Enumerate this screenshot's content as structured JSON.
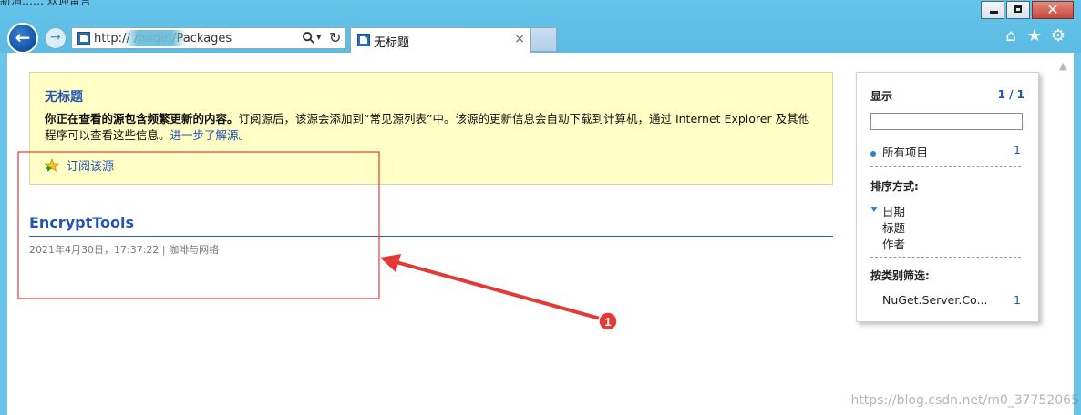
{
  "window": {
    "top_cut_text": "新消…… 欢迎留言",
    "close_glyph": "✕"
  },
  "nav": {
    "back_glyph": "←",
    "forward_glyph": "→"
  },
  "address_bar": {
    "url": "http://                  /nuget/Packages",
    "dropdown_glyph": "▾",
    "refresh_glyph": "↻"
  },
  "tab": {
    "title": "无标题",
    "close_glyph": "×"
  },
  "toolbar": {
    "home_glyph": "⌂",
    "favorites_glyph": "★",
    "settings_glyph": "⚙"
  },
  "feed_info": {
    "title": "无标题",
    "desc_bold": "你正在查看的源包含频繁更新的内容。",
    "desc_text": "订阅源后，该源会添加到“常见源列表”中。该源的更新信息会自动下载到计算机，通过 Internet Explorer 及其他程序可以查看这些信息。",
    "learn_more": "进一步了解源。",
    "subscribe_label": "订阅该源"
  },
  "entry": {
    "title": "EncryptTools",
    "meta": "2021年4月30日，17:37:22 | 咖啡与网络"
  },
  "sidebar": {
    "display_label": "显示",
    "display_count": "1 / 1",
    "search_value": "",
    "all_items_label": "所有项目",
    "all_items_count": "1",
    "sort_label": "排序方式:",
    "sort_options": [
      "日期",
      "标题",
      "作者"
    ],
    "filter_label": "按类别筛选:",
    "filter_item_label": "NuGet.Server.Co...",
    "filter_item_count": "1"
  },
  "annotation": {
    "badge_label": "1",
    "color": "#e53935"
  },
  "watermark": "https://blog.csdn.net/m0_37752065"
}
